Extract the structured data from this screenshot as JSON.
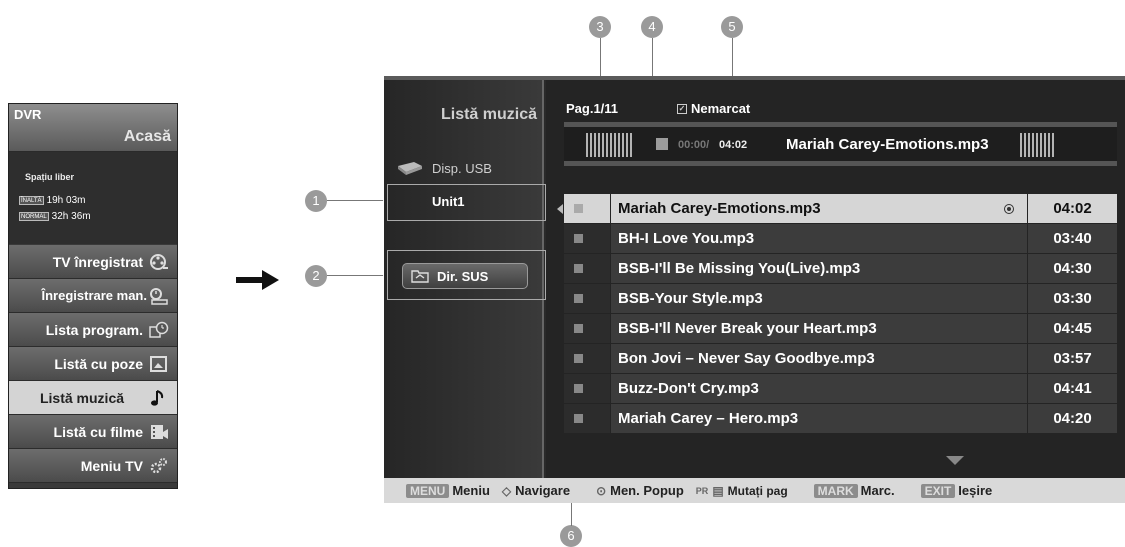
{
  "dvr_menu": {
    "title": "DVR",
    "home": "Acasă",
    "free_space_label": "Spațiu liber",
    "high_quality_badge": "ÎNALTĂ",
    "high_quality_time": "19h 03m",
    "normal_quality_badge": "NORMAL",
    "normal_quality_time": "32h 36m",
    "items": [
      {
        "label": "TV înregistrat",
        "icon": "film-reel-icon"
      },
      {
        "label": "Înregistrare man.",
        "icon": "manual-record-icon"
      },
      {
        "label": "Lista program.",
        "icon": "schedule-clock-icon"
      },
      {
        "label": "Listă cu poze",
        "icon": "photo-icon"
      },
      {
        "label": "Listă muzică",
        "icon": "music-note-icon",
        "selected": true
      },
      {
        "label": "Listă cu filme",
        "icon": "movie-icon"
      },
      {
        "label": "Meniu TV",
        "icon": "gears-icon"
      }
    ]
  },
  "callouts": [
    "1",
    "2",
    "3",
    "4",
    "5",
    "6"
  ],
  "screen": {
    "title": "Listă muzică",
    "device_label": "Disp. USB",
    "unit_label": "Unit1",
    "dir_up_label": "Dir. SUS",
    "page_label": "Pag.1/11",
    "unmarked_label": "Nemarcat",
    "player": {
      "elapsed": "00:00/",
      "total": "04:02",
      "now_playing": "Mariah Carey-Emotions.mp3"
    },
    "tracks": [
      {
        "name": "Mariah Carey-Emotions.mp3",
        "time": "04:02",
        "active": true
      },
      {
        "name": "BH-I Love You.mp3",
        "time": "03:40"
      },
      {
        "name": "BSB-I'll Be Missing You(Live).mp3",
        "time": "04:30"
      },
      {
        "name": "BSB-Your Style.mp3",
        "time": "03:30"
      },
      {
        "name": "BSB-I'll Never Break your Heart.mp3",
        "time": "04:45"
      },
      {
        "name": "Bon Jovi – Never Say Goodbye.mp3",
        "time": "03:57"
      },
      {
        "name": "Buzz-Don't Cry.mp3",
        "time": "04:41"
      },
      {
        "name": "Mariah Carey – Hero.mp3",
        "time": "04:20"
      }
    ],
    "bottom_bar": {
      "menu_key": "MENU",
      "menu_label": "Meniu",
      "nav_label": "Navigare",
      "popup_label": "Men. Popup",
      "page_key": "PR",
      "page_label": "Mutați pag",
      "mark_key": "MARK",
      "mark_label": "Marc.",
      "exit_key": "EXIT",
      "exit_label": "Ieșire"
    }
  },
  "colors": {
    "menu_bg": "#4b4b4b",
    "selected_bg": "#d4d4d4",
    "screen_bg": "#242424",
    "callout": "#9a9a9a"
  }
}
